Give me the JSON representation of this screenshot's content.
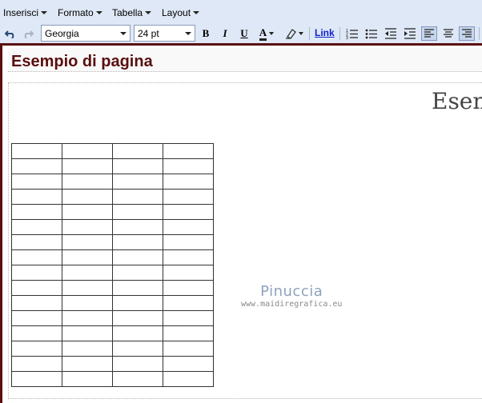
{
  "menubar": {
    "items": [
      {
        "label": "Inserisci"
      },
      {
        "label": "Formato"
      },
      {
        "label": "Tabella"
      },
      {
        "label": "Layout"
      }
    ]
  },
  "toolbar": {
    "font_family": "Georgia",
    "font_size": "24 pt",
    "link_label": "Link",
    "bold_label": "B",
    "italic_label": "I",
    "underline_label": "U",
    "text_color_label": "A"
  },
  "document": {
    "page_title": "Esempio di pagina",
    "heading_visible": "Esem",
    "table": {
      "rows": 16,
      "columns": 4
    },
    "watermark": {
      "name": "Pinuccia",
      "url": "www.maidiregrafica.eu"
    }
  },
  "colors": {
    "frame": "#5a0f0f",
    "toolbar_bg": "#dfe8f6",
    "title_text": "#5a0f0f"
  }
}
